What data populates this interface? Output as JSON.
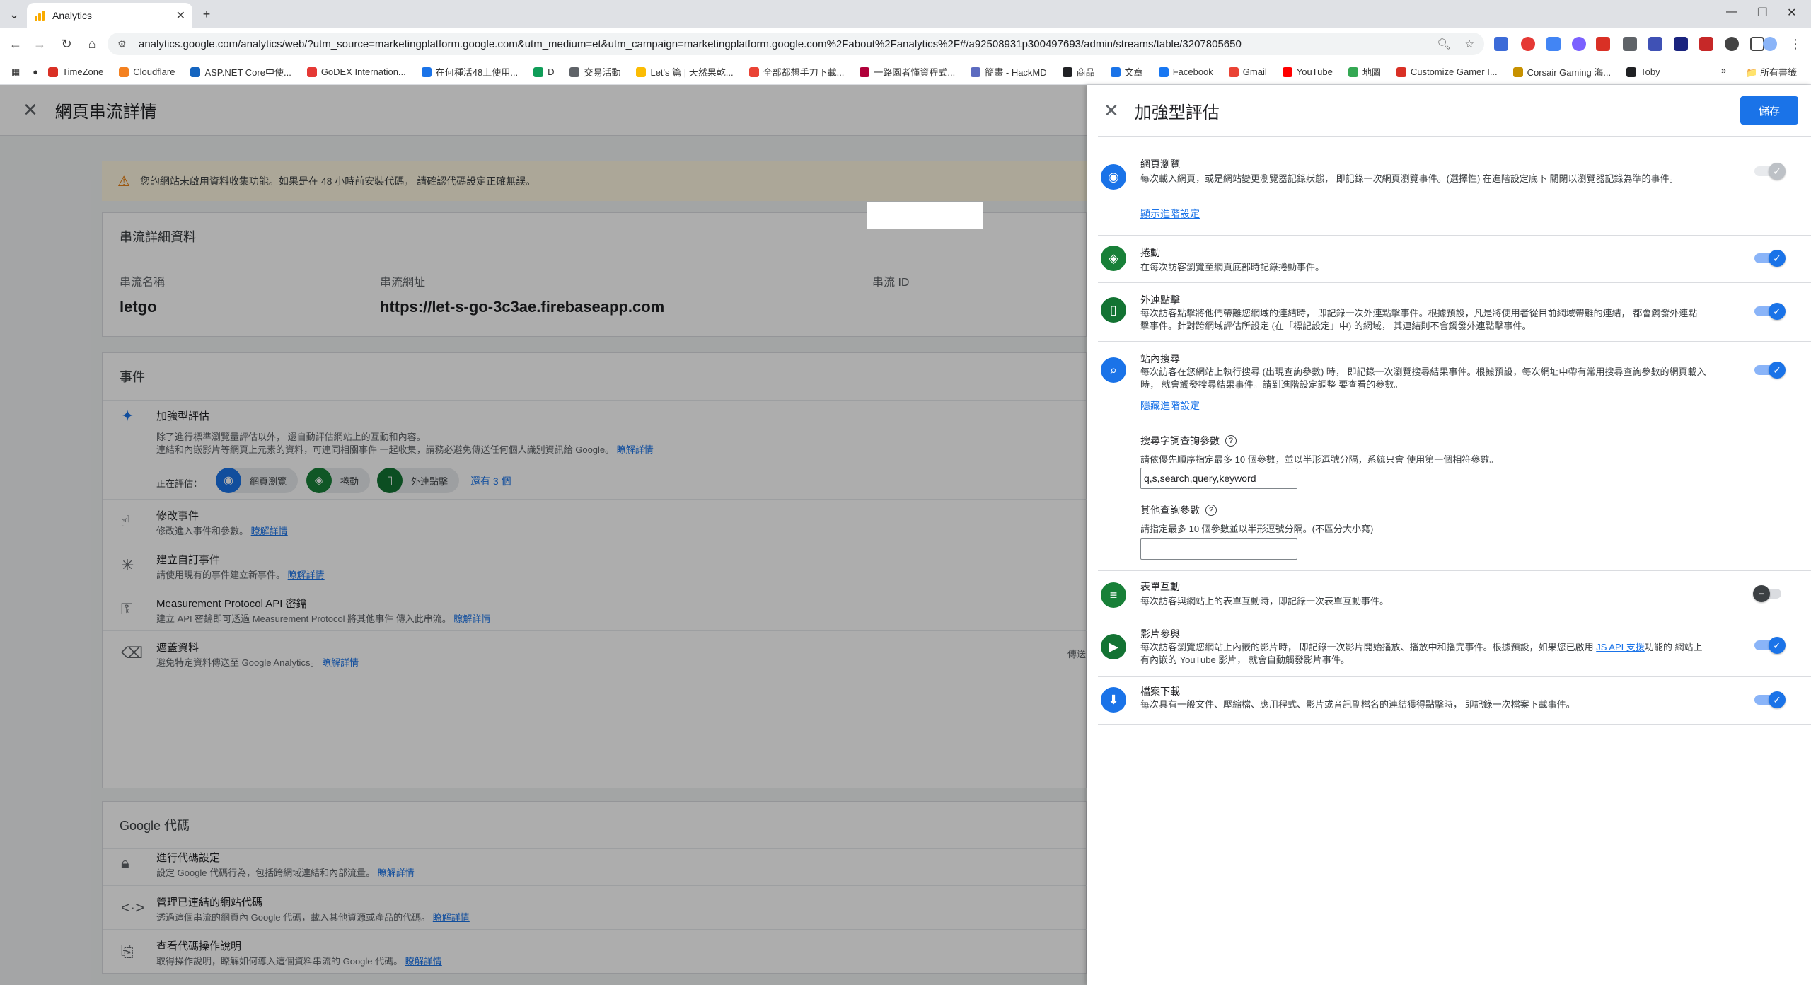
{
  "browser": {
    "tab_title": "Analytics",
    "url": "analytics.google.com/analytics/web/?utm_source=marketingplatform.google.com&utm_medium=et&utm_campaign=marketingplatform.google.com%2Fabout%2Fanalytics%2F#/a92508931p300497693/admin/streams/table/3207805650",
    "bookmarks": [
      "TimeZone",
      "Cloudflare",
      "ASP.NET Core中使...",
      "GoDEX Internation...",
      "在何種活48上使用...",
      "D",
      "交易活動",
      "Let's 篇 | 天然果乾...",
      "全部都想手刀下載...",
      "一路園者懂資程式...",
      "簡畫 - HackMD",
      "商品",
      "文章",
      "Facebook",
      "Gmail",
      "YouTube",
      "地圖",
      "Customize Gamer I...",
      "Corsair Gaming 海...",
      "Toby"
    ],
    "bookmark_colors": [
      "#d93025",
      "#f48120",
      "#1565c0",
      "#e53935",
      "#1a73e8",
      "#0f9d58",
      "#5f6368",
      "#fbbc04",
      "#ea4335",
      "#b0003a",
      "#5c6bc0",
      "#202124",
      "#1a73e8",
      "#1877f2",
      "#ea4335",
      "#ff0000",
      "#34a853",
      "#d93025",
      "#c79100",
      "#202124"
    ],
    "all_bookmarks": "所有書籤"
  },
  "page": {
    "title": "網頁串流詳情",
    "warning": "您的網站未啟用資料收集功能。如果是在 48 小時前安裝代碼， 請確認代碼設定正確無誤。",
    "details": {
      "heading": "串流詳細資料",
      "name_label": "串流名稱",
      "name_value": "letgo",
      "url_label": "串流網址",
      "url_value": "https://let-s-go-3c3ae.firebaseapp.com",
      "id_label": "串流 ID"
    },
    "events": {
      "heading": "事件",
      "enhanced_title": "加強型評估",
      "enhanced_desc1": "除了進行標準瀏覽量評估以外， 還自動評估網站上的互動和內容。",
      "enhanced_desc2": "連結和內嵌影片等網頁上元素的資料，可連同相關事件 一起收集，請務必避免傳送任何個人識別資訊給 Google。",
      "learn_more": "瞭解詳情",
      "measuring_label": "正在評估：",
      "chips": [
        "網頁瀏覽",
        "捲動",
        "外連點擊"
      ],
      "more": "還有 3 個",
      "rows": [
        {
          "title": "修改事件",
          "desc": "修改進入事件和參數。"
        },
        {
          "title": "建立自訂事件",
          "desc": "請使用現有的事件建立新事件。"
        },
        {
          "title": "Measurement Protocol API 密鑰",
          "desc": "建立 API 密鑰即可透過 Measurement Protocol 將其他事件 傳入此串流。"
        },
        {
          "title": "遮蓋資料",
          "desc": "避免特定資料傳送至 Google Analytics。"
        }
      ],
      "side_note": "傳送"
    },
    "tag": {
      "heading": "Google 代碼",
      "rows": [
        {
          "title": "進行代碼設定",
          "desc": "設定 Google 代碼行為，包括跨網域連結和內部流量。"
        },
        {
          "title": "管理已連結的網站代碼",
          "desc": "透過這個串流的網頁內 Google 代碼，載入其他資源或產品的代碼。"
        },
        {
          "title": "查看代碼操作說明",
          "desc": "取得操作說明，瞭解如何導入這個資料串流的 Google 代碼。"
        }
      ]
    }
  },
  "panel": {
    "title": "加強型評估",
    "save": "儲存",
    "items": [
      {
        "title": "網頁瀏覽",
        "desc": "每次載入網頁，或是網站變更瀏覽器記錄狀態， 即記錄一次網頁瀏覽事件。(選擇性) 在進階設定底下 關閉以瀏覽器記錄為準的事件。",
        "link": "顯示進階設定",
        "state": "disabled"
      },
      {
        "title": "捲動",
        "desc": "在每次訪客瀏覽至網頁底部時記錄捲動事件。",
        "state": "on"
      },
      {
        "title": "外連點擊",
        "desc": "每次訪客點擊將他們帶離您網域的連結時， 即記錄一次外連點擊事件。根據預設，凡是將使用者從目前網域帶離的連結， 都會觸發外連點擊事件。針對跨網域評估所設定 (在「標記設定」中) 的網域， 其連結則不會觸發外連點擊事件。",
        "state": "on"
      },
      {
        "title": "站內搜尋",
        "desc": "每次訪客在您網站上執行搜尋 (出現查詢參數) 時， 即記錄一次瀏覽搜尋結果事件。根據預設，每次網址中帶有常用搜尋查詢參數的網頁載入時， 就會觸發搜尋結果事件。請到進階設定調整 要查看的參數。",
        "link": "隱藏進階設定",
        "state": "on"
      },
      {
        "title": "表單互動",
        "desc": "每次訪客與網站上的表單互動時，即記錄一次表單互動事件。",
        "state": "off"
      },
      {
        "title": "影片參與",
        "desc_a": "每次訪客瀏覽您網站上內嵌的影片時， 即記錄一次影片開始播放、播放中和播完事件。根據預設，如果您已啟用 ",
        "desc_link": "JS API 支援",
        "desc_b": "功能的 網站上有內嵌的 YouTube 影片， 就會自動觸發影片事件。",
        "state": "on"
      },
      {
        "title": "檔案下載",
        "desc": "每次具有一般文件、壓縮檔、應用程式、影片或音訊副檔名的連結獲得點擊時， 即記錄一次檔案下載事件。",
        "state": "on"
      }
    ],
    "search_params": {
      "label": "搜尋字詞查詢參數",
      "desc": "請依優先順序指定最多 10 個參數，並以半形逗號分隔，系統只會 使用第一個相符參數。",
      "value": "q,s,search,query,keyword"
    },
    "other_params": {
      "label": "其他查詢參數",
      "desc": "請指定最多 10 個參數並以半形逗號分隔。(不區分大小寫)",
      "value": ""
    }
  },
  "colors": {
    "blue": "#1a73e8",
    "green": "#188038",
    "darkgreen": "#137333",
    "accent_yellow": "#f9ab00"
  }
}
